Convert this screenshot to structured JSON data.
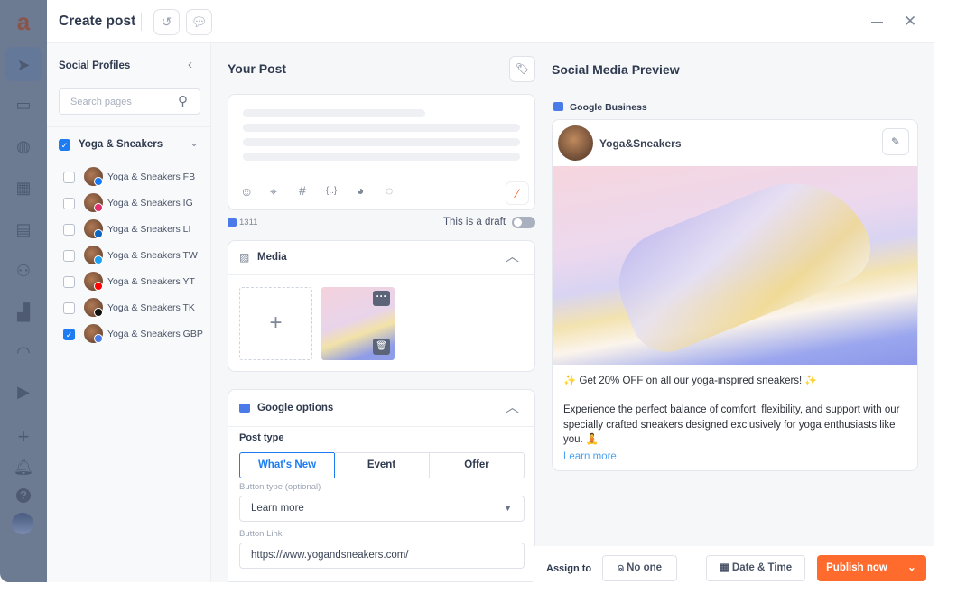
{
  "header": {
    "title": "Create post",
    "history_icon": "history-icon",
    "comments_icon": "comments-icon",
    "minimize_icon": "minimize-icon",
    "close_icon": "close-icon"
  },
  "rail": {
    "items": [
      "send-icon",
      "inbox-icon",
      "web-search-icon",
      "calendar-icon",
      "planner-icon",
      "team-icon",
      "analytics-icon",
      "dashboard-icon",
      "media-library-icon",
      "add-icon",
      "bell-icon",
      "help-icon",
      "user-avatar"
    ]
  },
  "profiles": {
    "title": "Social Profiles",
    "search_placeholder": "Search pages",
    "group": {
      "label": "Yoga & Sneakers",
      "checked": true
    },
    "items": [
      {
        "label": "Yoga & Sneakers FB",
        "checked": false,
        "network": "facebook",
        "color": "#1877f2"
      },
      {
        "label": "Yoga & Sneakers IG",
        "checked": false,
        "network": "instagram",
        "color": "#e1306c"
      },
      {
        "label": "Yoga & Sneakers LI",
        "checked": false,
        "network": "linkedin",
        "color": "#0a66c2"
      },
      {
        "label": "Yoga & Sneakers TW",
        "checked": false,
        "network": "twitter",
        "color": "#1da1f2"
      },
      {
        "label": "Yoga & Sneakers YT",
        "checked": false,
        "network": "youtube",
        "color": "#ff0000"
      },
      {
        "label": "Yoga & Sneakers TK",
        "checked": false,
        "network": "tiktok",
        "color": "#111111"
      },
      {
        "label": "Yoga & Sneakers GBP",
        "checked": true,
        "network": "google-business",
        "color": "#4a7be8"
      }
    ]
  },
  "post": {
    "title": "Your Post",
    "char_count": "1311",
    "draft_label": "This is a draft",
    "draft_on": false,
    "media": {
      "title": "Media"
    },
    "google": {
      "title": "Google options",
      "post_type_label": "Post type",
      "post_types": [
        "What's New",
        "Event",
        "Offer"
      ],
      "selected": "What's New",
      "button_type_label": "Button type (optional)",
      "button_type_value": "Learn more",
      "button_link_label": "Button Link",
      "button_link_value": "https://www.yogandsneakers.com/"
    }
  },
  "preview": {
    "title": "Social Media Preview",
    "network": "Google Business",
    "account": "Yoga&Sneakers",
    "line1": "✨ Get 20% OFF on all our yoga-inspired sneakers! ✨",
    "body": "Experience the perfect balance of comfort, flexibility, and support with our specially crafted sneakers designed exclusively for yoga enthusiasts like you. 🧘",
    "cta": "Learn more"
  },
  "footer": {
    "assign_label": "Assign to",
    "assignee": "No one",
    "date_label": "Date & Time",
    "publish_label": "Publish now"
  },
  "colors": {
    "accent": "#ff6b2c",
    "primary": "#1d7cf2",
    "link": "#4aa3f0"
  }
}
